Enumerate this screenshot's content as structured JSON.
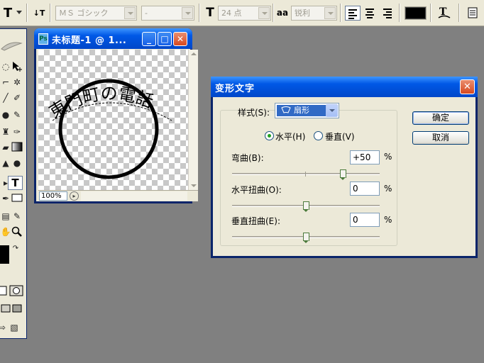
{
  "options_bar": {
    "tool_icon": "T",
    "orientation_icon": "↓T",
    "font_family": "ＭＳ ゴシック",
    "font_style": "-",
    "size_icon": "T",
    "font_size": "24 点",
    "aa_icon": "aa",
    "antialias": "锐利",
    "text_color": "#000000",
    "warp_icon": "warp-text-icon",
    "palettes_icon": "palettes-icon"
  },
  "tools": {
    "type_tool_label": "T",
    "foreground_color": "#000000",
    "background_color": "#ffffff"
  },
  "document": {
    "title": "未标题-1 @ 1...",
    "zoom": "100%",
    "icon_label": "Ps",
    "minimize_label": "_",
    "maximize_label": "□",
    "close_label": "✕",
    "artwork": {
      "arc_text": "東門町の電話",
      "stroke_color": "#000000"
    }
  },
  "warp_dialog": {
    "title": "变形文字",
    "close_label": "✕",
    "style_label": "样式(S):",
    "style_value": "扇形",
    "horizontal_label": "水平(H)",
    "vertical_label": "垂直(V)",
    "orientation": "horizontal",
    "bend_label": "弯曲(B):",
    "bend_value": "+50",
    "bend_fraction": 0.75,
    "horiz_distort_label": "水平扭曲(O):",
    "horiz_distort_value": "0",
    "horiz_distort_fraction": 0.5,
    "vert_distort_label": "垂直扭曲(E):",
    "vert_distort_value": "0",
    "vert_distort_fraction": 0.5,
    "percent": "%",
    "ok_label": "确定",
    "cancel_label": "取消"
  }
}
